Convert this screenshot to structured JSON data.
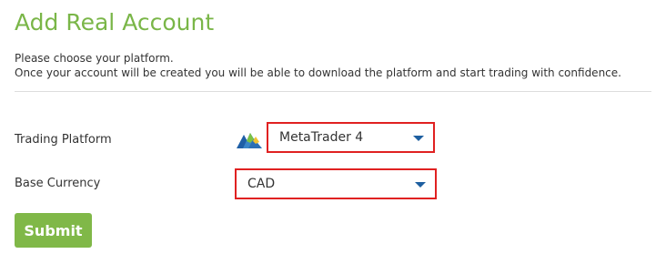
{
  "page": {
    "title": "Add Real Account",
    "description_line1": "Please choose your platform.",
    "description_line2": "Once your account will be created you will be able to download the platform and start trading with confidence."
  },
  "form": {
    "platform_label": "Trading Platform",
    "platform_value": "MetaTrader 4",
    "platform_icon": "metatrader-logo-icon",
    "currency_label": "Base Currency",
    "currency_value": "CAD",
    "submit_label": "Submit"
  },
  "colors": {
    "title": "#7ab648",
    "highlight_border": "#e02121",
    "submit_bg": "#80b848",
    "caret": "#1e5fa0"
  }
}
